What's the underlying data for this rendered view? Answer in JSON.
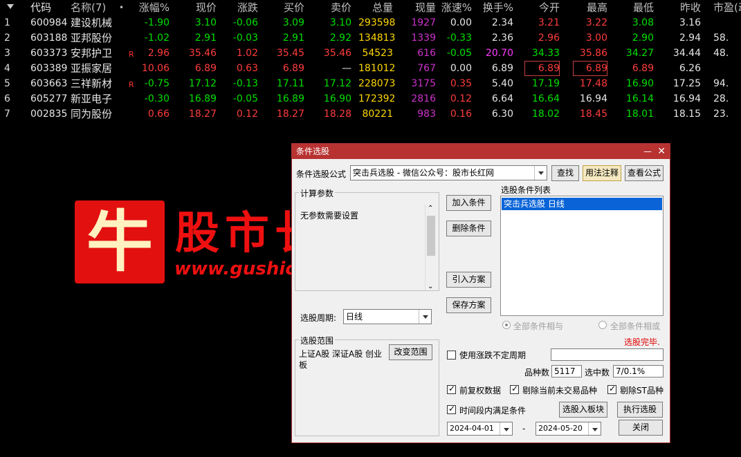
{
  "header": {
    "code": "代码",
    "name": "名称(7)",
    "dot": "•",
    "cols": [
      "涨幅%",
      "现价",
      "涨跌",
      "买价",
      "卖价",
      "总量",
      "现量",
      "涨速%",
      "换手%",
      "今开",
      "最高",
      "最低",
      "昨收",
      "市盈(动"
    ]
  },
  "rows": [
    {
      "idx": "1",
      "code": "600984",
      "name": "建设机械",
      "flag": "",
      "v": [
        "-1.90",
        "3.10",
        "-0.06",
        "3.09",
        "3.10",
        "293598",
        "1927",
        "0.00",
        "2.34",
        "3.21",
        "3.22",
        "3.08",
        "3.16",
        ""
      ]
    },
    {
      "idx": "2",
      "code": "603188",
      "name": "亚邦股份",
      "flag": "",
      "v": [
        "-1.02",
        "2.91",
        "-0.03",
        "2.91",
        "2.92",
        "134813",
        "1339",
        "-0.33",
        "2.36",
        "2.96",
        "3.00",
        "2.90",
        "2.94",
        "58."
      ]
    },
    {
      "idx": "3",
      "code": "603373",
      "name": "安邦护卫",
      "flag": "R",
      "v": [
        "2.96",
        "35.46",
        "1.02",
        "35.45",
        "35.46",
        "54523",
        "616",
        "-0.05",
        "20.70",
        "34.33",
        "35.86",
        "34.27",
        "34.44",
        "48."
      ]
    },
    {
      "idx": "4",
      "code": "603389",
      "name": "亚振家居",
      "flag": "",
      "v": [
        "10.06",
        "6.89",
        "0.63",
        "6.89",
        "—",
        "181012",
        "767",
        "0.00",
        "6.89",
        "6.89",
        "6.89",
        "6.89",
        "6.26",
        ""
      ]
    },
    {
      "idx": "5",
      "code": "603663",
      "name": "三祥新材",
      "flag": "R",
      "v": [
        "-0.75",
        "17.12",
        "-0.13",
        "17.11",
        "17.12",
        "228073",
        "3175",
        "0.35",
        "5.40",
        "17.19",
        "17.48",
        "16.90",
        "17.25",
        "94."
      ]
    },
    {
      "idx": "6",
      "code": "605277",
      "name": "新亚电子",
      "flag": "",
      "v": [
        "-0.30",
        "16.89",
        "-0.05",
        "16.89",
        "16.90",
        "172392",
        "2816",
        "0.12",
        "6.64",
        "16.64",
        "16.94",
        "16.14",
        "16.94",
        "28."
      ]
    },
    {
      "idx": "7",
      "code": "002835",
      "name": "同为股份",
      "flag": "",
      "v": [
        "0.66",
        "18.27",
        "0.12",
        "18.27",
        "18.28",
        "80221",
        "983",
        "0.16",
        "6.30",
        "18.02",
        "18.45",
        "18.01",
        "18.15",
        "23."
      ]
    }
  ],
  "watermark": {
    "logo_char": "牛",
    "title": "股市长红",
    "url": "www.gushichanghong.com"
  },
  "dialog": {
    "title": "条件选股",
    "min_btn": "—",
    "close_btn": "✕",
    "formula_label": "条件选股公式",
    "formula_value": "突击兵选股  -  微信公众号：股市长红网",
    "find_btn": "查找",
    "usage_btn": "用法注释",
    "view_btn": "查看公式",
    "params_group": "计算参数",
    "params_text": "无参数需要设置",
    "add_btn": "加入条件",
    "del_btn": "删除条件",
    "import_btn": "引入方案",
    "save_btn": "保存方案",
    "cond_list_label": "选股条件列表",
    "cond_items": [
      "突击兵选股  日线"
    ],
    "period_label": "选股周期:",
    "period_value": "日线",
    "radio_and": "全部条件相与",
    "radio_or": "全部条件相或",
    "status": "选股完毕.",
    "range_group": "选股范围",
    "range_text": "上证A股 深证A股 创业板",
    "change_range_btn": "改变范围",
    "uncertain_label": "使用涨跌不定周期",
    "count_label": "品种数",
    "count_value": "5117",
    "selected_label": "选中数",
    "selected_value": "7/0.1%",
    "fq_label": "前复权数据",
    "remove_nontrade_label": "剔除当前未交易品种",
    "remove_st_label": "剔除ST品种",
    "period_cond_label": "时间段内满足条件",
    "to_block_btn": "选股入板块",
    "exec_btn": "执行选股",
    "date_from": "2024-04-01",
    "date_sep": "-",
    "date_to": "2024-05-20",
    "close_dlg_btn": "关闭"
  },
  "colors": {
    "up": "#ff3c3c",
    "down": "#00e000",
    "volume": "#ffd800",
    "now_volume": "#cc33cc",
    "dialog_title": "#b83232",
    "selection": "#0a64d8"
  }
}
